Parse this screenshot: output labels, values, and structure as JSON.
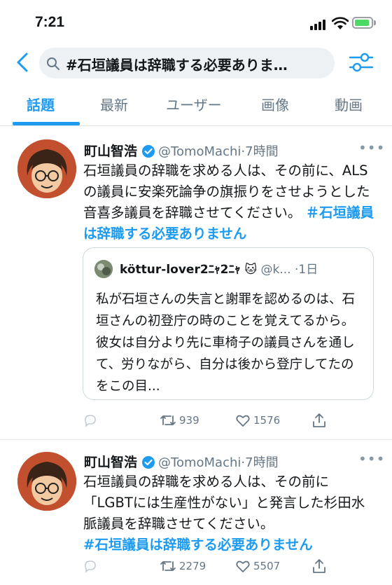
{
  "status_bar": {
    "time": "7:21"
  },
  "search": {
    "query": "#石垣議員は辞職する必要ありま…"
  },
  "tabs": [
    {
      "label": "話題",
      "active": true
    },
    {
      "label": "最新",
      "active": false
    },
    {
      "label": "ユーザー",
      "active": false
    },
    {
      "label": "画像",
      "active": false
    },
    {
      "label": "動画",
      "active": false
    }
  ],
  "tweets": [
    {
      "name": "町山智浩",
      "handle": "@TomoMachi",
      "time": "·7時間",
      "text": "石垣議員の辞職を求める人は、その前に、ALSの議員に安楽死論争の旗振りをさせようとした音喜多議員を辞職させてください。",
      "hashtag": "＃石垣議員は辞職する必要ありません",
      "quote": {
        "name": "köttur-lover2ﾆｬ2ﾆｬ 🐱",
        "handle": "@k...",
        "time": "·1日",
        "text": "私が石垣さんの失言と謝罪を認めるのは、石垣さんの初登庁の時のことを覚えてるから。彼女は自分より先に車椅子の議員さんを通して、労りながら、自分は後から登庁してたのをこの目..."
      },
      "retweets": "939",
      "likes": "1576"
    },
    {
      "name": "町山智浩",
      "handle": "@TomoMachi",
      "time": "·7時間",
      "text": "石垣議員の辞職を求める人は、その前に「LGBTには生産性がない」と発言した杉田水脈議員を辞職させてください。",
      "hashtag": "#石垣議員は辞職する必要ありません",
      "retweets": "2279",
      "likes": "5507"
    }
  ],
  "icons": {
    "back": "chevron-left-icon",
    "search": "search-icon",
    "filter": "sliders-icon",
    "verified": "verified-badge-icon",
    "more": "more-icon",
    "reply": "reply-icon",
    "retweet": "retweet-icon",
    "like": "heart-icon",
    "share": "share-icon"
  },
  "colors": {
    "accent": "#1d9bf0",
    "secondary_text": "#657786",
    "battery": "#4cd964"
  }
}
